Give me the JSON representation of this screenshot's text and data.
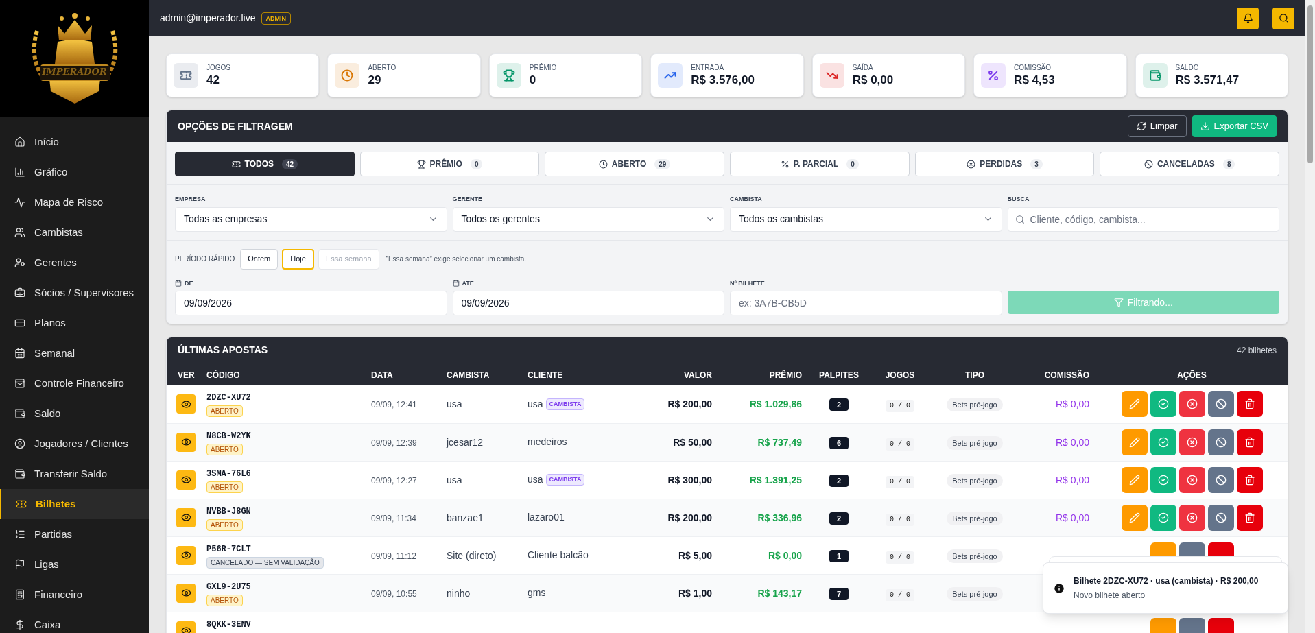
{
  "sidebar": {
    "logo_text": "IMPERADOR",
    "items": [
      {
        "label": "Início",
        "selected": false
      },
      {
        "label": "Gráfico",
        "selected": false
      },
      {
        "label": "Mapa de Risco",
        "selected": false
      },
      {
        "label": "Cambistas",
        "selected": false
      },
      {
        "label": "Gerentes",
        "selected": false
      },
      {
        "label": "Sócios / Supervisores",
        "selected": false
      },
      {
        "label": "Planos",
        "selected": false
      },
      {
        "label": "Semanal",
        "selected": false
      },
      {
        "label": "Controle Financeiro",
        "selected": false
      },
      {
        "label": "Saldo",
        "selected": false
      },
      {
        "label": "Jogadores / Clientes",
        "selected": false
      },
      {
        "label": "Transferir Saldo",
        "selected": false
      },
      {
        "label": "Bilhetes",
        "selected": true
      },
      {
        "label": "Partidas",
        "selected": false
      },
      {
        "label": "Ligas",
        "selected": false
      },
      {
        "label": "Financeiro",
        "selected": false
      },
      {
        "label": "Caixa",
        "selected": false
      }
    ]
  },
  "topbar": {
    "user": "admin@imperador.live",
    "role": "ADMIN"
  },
  "stats": [
    {
      "label": "JOGOS",
      "value": "42",
      "color": "#64748b"
    },
    {
      "label": "ABERTO",
      "value": "29",
      "color": "#d97706"
    },
    {
      "label": "PRÊMIO",
      "value": "0",
      "color": "#059669"
    },
    {
      "label": "ENTRADA",
      "value": "R$ 3.576,00",
      "color": "#2563eb"
    },
    {
      "label": "SAÍDA",
      "value": "R$ 0,00",
      "color": "#dc2626"
    },
    {
      "label": "COMISSÃO",
      "value": "R$ 4,53",
      "color": "#7c3aed"
    },
    {
      "label": "SALDO",
      "value": "R$ 3.571,47",
      "color": "#059669"
    }
  ],
  "filters": {
    "title": "OPÇÕES DE FILTRAGEM",
    "clear_button": "Limpar",
    "export_button": "Exportar CSV",
    "tabs": [
      {
        "label": "TODOS",
        "count": "42",
        "selected": true
      },
      {
        "label": "PRÊMIO",
        "count": "0",
        "selected": false
      },
      {
        "label": "ABERTO",
        "count": "29",
        "selected": false
      },
      {
        "label": "P. PARCIAL",
        "count": "0",
        "selected": false
      },
      {
        "label": "PERDIDAS",
        "count": "3",
        "selected": false
      },
      {
        "label": "CANCELADAS",
        "count": "8",
        "selected": false
      }
    ],
    "selects": [
      {
        "label": "EMPRESA",
        "value": "Todas as empresas"
      },
      {
        "label": "GERENTE",
        "value": "Todos os gerentes"
      },
      {
        "label": "CAMBISTA",
        "value": "Todos os cambistas"
      }
    ],
    "search": {
      "label": "BUSCA",
      "placeholder": "Cliente, código, cambista..."
    },
    "period": {
      "label": "PERÍODO RÁPIDO",
      "options": [
        {
          "label": "Ontem",
          "selected": false,
          "disabled": false
        },
        {
          "label": "Hoje",
          "selected": true,
          "disabled": false
        },
        {
          "label": "Essa semana",
          "selected": false,
          "disabled": true
        }
      ],
      "hint": "“Essa semana” exige selecionar um cambista."
    },
    "dates": [
      {
        "label": "DE",
        "value": "09/09/2026"
      },
      {
        "label": "ATÉ",
        "value": "09/09/2026"
      }
    ],
    "ticket": {
      "label": "Nº BILHETE",
      "placeholder": "ex: 3A7B-CB5D"
    },
    "submit": {
      "label": "Filtrando...",
      "disabled": true
    }
  },
  "table": {
    "title": "ÚLTIMAS APOSTAS",
    "count": "42 bilhetes",
    "columns": [
      "VER",
      "CÓDIGO",
      "DATA",
      "CAMBISTA",
      "CLIENTE",
      "VALOR",
      "PRÊMIO",
      "PALPITES",
      "JOGOS",
      "TIPO",
      "COMISSÃO",
      "AÇÕES"
    ],
    "rows": [
      {
        "code": "2DZC-XU72",
        "status": {
          "kind": "open",
          "label": "ABERTO"
        },
        "date": "09/09, 12:41",
        "cambista": "usa",
        "client": "usa",
        "client_badge": "CAMBISTA",
        "value": "R$ 200,00",
        "prize": "R$ 1.029,86",
        "picks": "2",
        "games": "0 / 0",
        "type": "Bets pré-jogo",
        "commission": "R$ 0,00",
        "actions": [
          {
            "kind": "edit"
          },
          {
            "kind": "win"
          },
          {
            "kind": "lose"
          },
          {
            "kind": "cancel"
          },
          {
            "kind": "delete"
          }
        ]
      },
      {
        "code": "N8CB-W2YK",
        "status": {
          "kind": "open",
          "label": "ABERTO"
        },
        "date": "09/09, 12:39",
        "cambista": "jcesar12",
        "client": "medeiros",
        "value": "R$ 50,00",
        "prize": "R$ 737,49",
        "picks": "6",
        "games": "0 / 0",
        "type": "Bets pré-jogo",
        "commission": "R$ 0,00",
        "actions": [
          {
            "kind": "edit"
          },
          {
            "kind": "win"
          },
          {
            "kind": "lose"
          },
          {
            "kind": "cancel"
          },
          {
            "kind": "delete"
          }
        ]
      },
      {
        "code": "3SMA-76L6",
        "status": {
          "kind": "open",
          "label": "ABERTO"
        },
        "date": "09/09, 12:27",
        "cambista": "usa",
        "client": "usa",
        "client_badge": "CAMBISTA",
        "value": "R$ 300,00",
        "prize": "R$ 1.391,25",
        "picks": "2",
        "games": "0 / 0",
        "type": "Bets pré-jogo",
        "commission": "R$ 0,00",
        "actions": [
          {
            "kind": "edit"
          },
          {
            "kind": "win"
          },
          {
            "kind": "lose"
          },
          {
            "kind": "cancel"
          },
          {
            "kind": "delete"
          }
        ]
      },
      {
        "code": "NVBB-J8GN",
        "status": {
          "kind": "open",
          "label": "ABERTO"
        },
        "date": "09/09, 11:34",
        "cambista": "banzae1",
        "client": "lazaro01",
        "value": "R$ 200,00",
        "prize": "R$ 336,96",
        "picks": "2",
        "games": "0 / 0",
        "type": "Bets pré-jogo",
        "commission": "R$ 0,00",
        "actions": [
          {
            "kind": "edit"
          },
          {
            "kind": "win"
          },
          {
            "kind": "lose"
          },
          {
            "kind": "cancel"
          },
          {
            "kind": "delete"
          }
        ]
      },
      {
        "code": "P56R-7CLT",
        "status": {
          "kind": "cancelled",
          "label": "CANCELADO — SEM VALIDAÇÃO"
        },
        "date": "09/09, 11:12",
        "cambista": "Site (direto)",
        "client": "Cliente balcão",
        "value": "R$ 5,00",
        "prize": "R$ 0,00",
        "picks": "1",
        "games": "0 / 0",
        "type": "Bets pré-jogo",
        "actions": [
          {
            "kind": "edit"
          },
          {
            "kind": "cancel"
          },
          {
            "kind": "delete"
          }
        ]
      },
      {
        "code": "GXL9-2U75",
        "status": {
          "kind": "open",
          "label": "ABERTO"
        },
        "date": "09/09, 10:55",
        "cambista": "ninho",
        "client": "gms",
        "value": "R$ 1,00",
        "prize": "R$ 143,17",
        "picks": "7",
        "games": "0 / 0",
        "type": "Bets pré-jogo"
      },
      {
        "code": "8QKK-3ENV",
        "actions": [
          {
            "kind": "edit"
          },
          {
            "kind": "cancel"
          },
          {
            "kind": "delete"
          }
        ]
      }
    ]
  },
  "toast": {
    "title": "Bilhete 2DZC-XU72 · usa (cambista) · R$ 200,00",
    "message": "Novo bilhete aberto"
  }
}
